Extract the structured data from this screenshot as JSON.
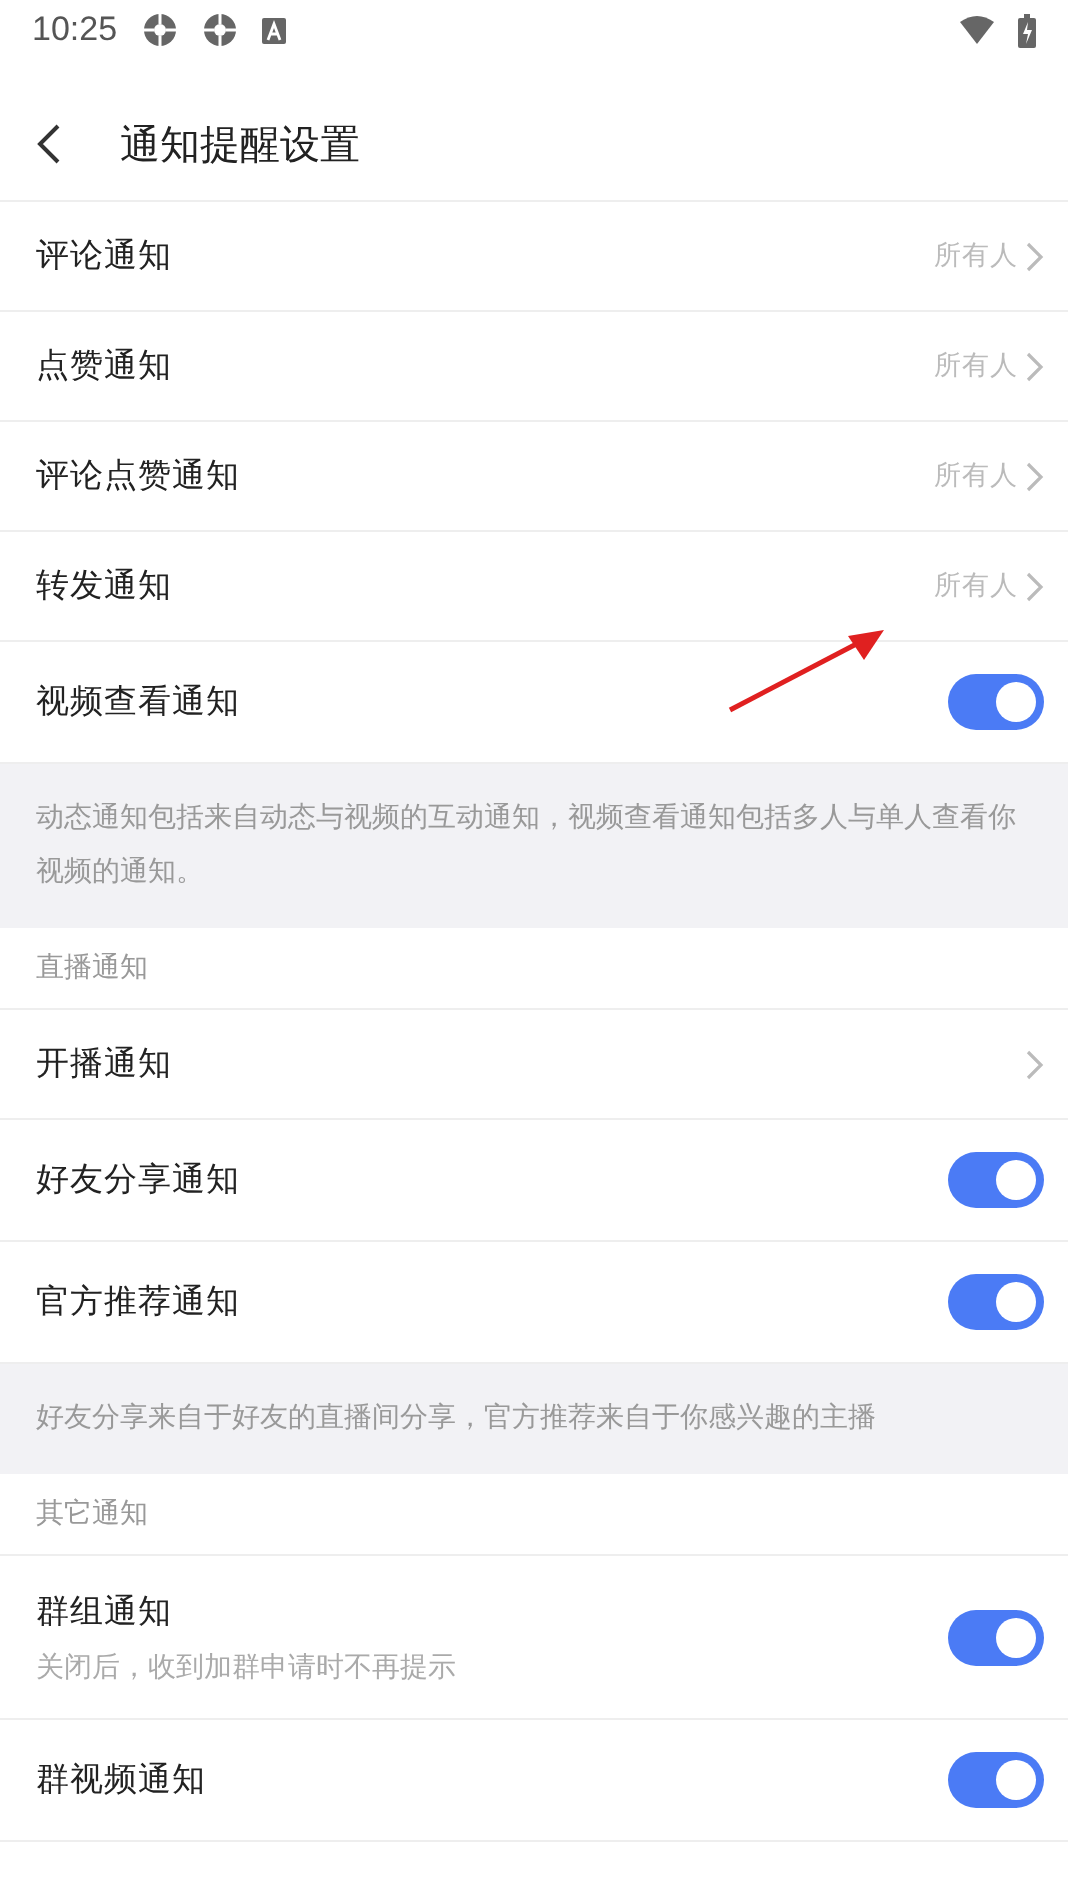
{
  "status_bar": {
    "time": "10:25"
  },
  "header": {
    "title": "通知提醒设置"
  },
  "sections": [
    {
      "rows": [
        {
          "kind": "link",
          "label": "评论通知",
          "value": "所有人"
        },
        {
          "kind": "link",
          "label": "点赞通知",
          "value": "所有人"
        },
        {
          "kind": "link",
          "label": "评论点赞通知",
          "value": "所有人"
        },
        {
          "kind": "link",
          "label": "转发通知",
          "value": "所有人"
        },
        {
          "kind": "toggle",
          "label": "视频查看通知",
          "on": true
        }
      ],
      "note": "动态通知包括来自动态与视频的互动通知，视频查看通知包括多人与单人查看你视频的通知。"
    },
    {
      "title": "直播通知",
      "rows": [
        {
          "kind": "link",
          "label": "开播通知"
        },
        {
          "kind": "toggle",
          "label": "好友分享通知",
          "on": true
        },
        {
          "kind": "toggle",
          "label": "官方推荐通知",
          "on": true
        }
      ],
      "note": "好友分享来自于好友的直播间分享，官方推荐来自于你感兴趣的主播"
    },
    {
      "title": "其它通知",
      "rows": [
        {
          "kind": "toggle",
          "label": "群组通知",
          "subtitle": "关闭后，收到加群申请时不再提示",
          "on": true
        },
        {
          "kind": "toggle",
          "label": "群视频通知",
          "on": true
        },
        {
          "kind": "blank"
        }
      ]
    }
  ]
}
